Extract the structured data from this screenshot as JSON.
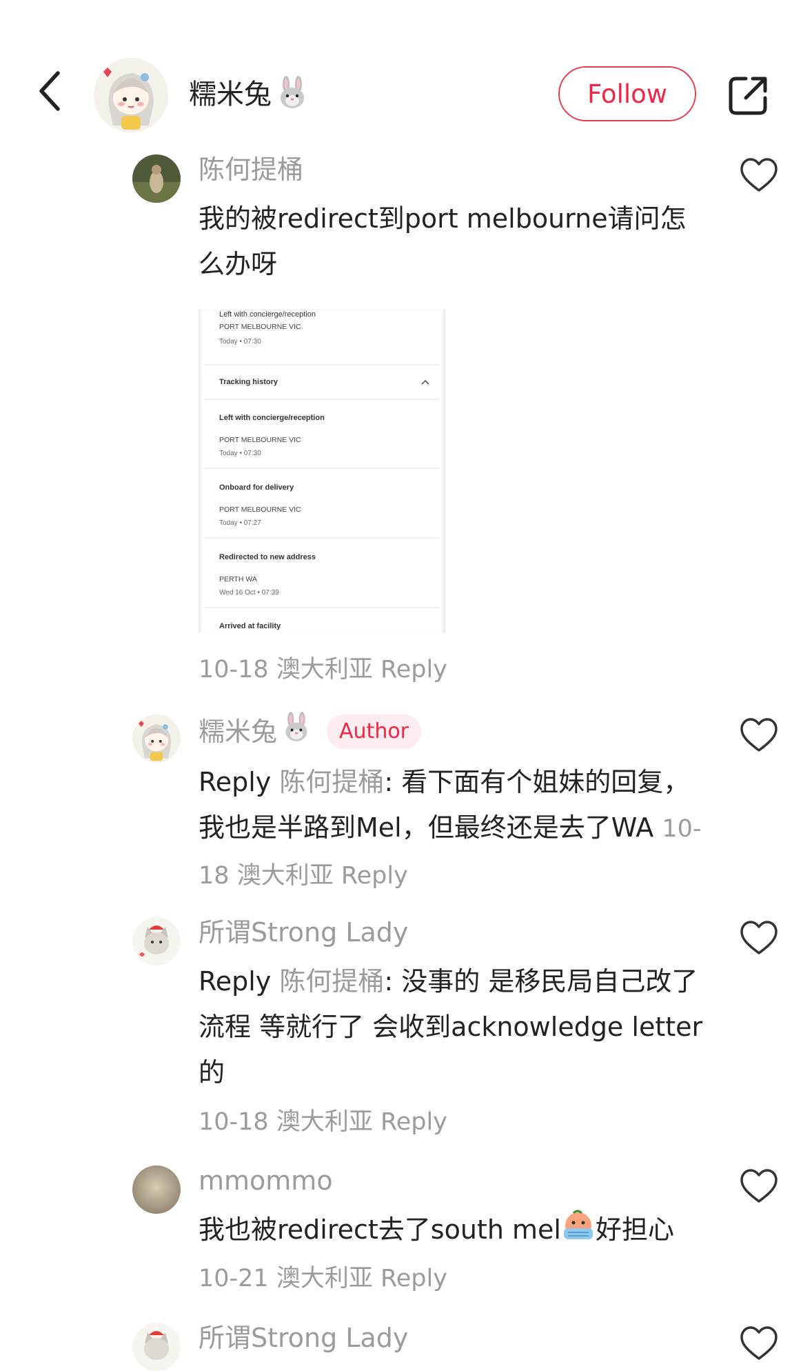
{
  "header": {
    "username": "糯米兔",
    "follow_label": "Follow",
    "back_icon": "chevron-left-icon",
    "share_icon": "share-out-icon"
  },
  "colors": {
    "accent": "#ee2746",
    "muted": "#9b9b9b",
    "text": "#222222",
    "badge_bg": "#fdecef"
  },
  "comments": [
    {
      "username": "陈何提桶",
      "text": "我的被redirect到port melbourne请问怎么办呀",
      "date": "10-18",
      "location": "澳大利亚",
      "reply_label": "Reply",
      "attachment": {
        "top_status": "Left with concierge/reception",
        "top_location": "PORT MELBOURNE VIC",
        "top_time": "Today • 07:30",
        "history_title": "Tracking history",
        "events": [
          {
            "status": "Left with concierge/reception",
            "location": "PORT MELBOURNE VIC",
            "time": "Today • 07:30"
          },
          {
            "status": "Onboard for delivery",
            "location": "PORT MELBOURNE VIC",
            "time": "Today • 07:27"
          },
          {
            "status": "Redirected to new address",
            "location": "PERTH WA",
            "time": "Wed 16 Oct • 07:39"
          },
          {
            "status": "Arrived at facility"
          }
        ]
      }
    },
    {
      "username": "糯米兔",
      "badge": "Author",
      "reply_prefix": "Reply",
      "mention": "陈何提桶",
      "text": ": 看下面有个姐妹的回复，我也是半路到Mel，但最终还是去了WA",
      "date": "10-18",
      "location": "澳大利亚",
      "reply_label": "Reply"
    },
    {
      "username": "所谓Strong Lady",
      "reply_prefix": "Reply",
      "mention": "陈何提桶",
      "text": ": 没事的 是移民局自己改了流程 等就行了 会收到acknowledge letter的",
      "date": "10-18",
      "location": "澳大利亚",
      "reply_label": "Reply"
    },
    {
      "username": "mmommo",
      "text": "我也被redirect去了south mel",
      "text_after_emoji": "好担心",
      "emoji": "grimacing-face-emoji",
      "date": "10-21",
      "location": "澳大利亚",
      "reply_label": "Reply"
    },
    {
      "username": "所谓Strong Lady"
    }
  ]
}
